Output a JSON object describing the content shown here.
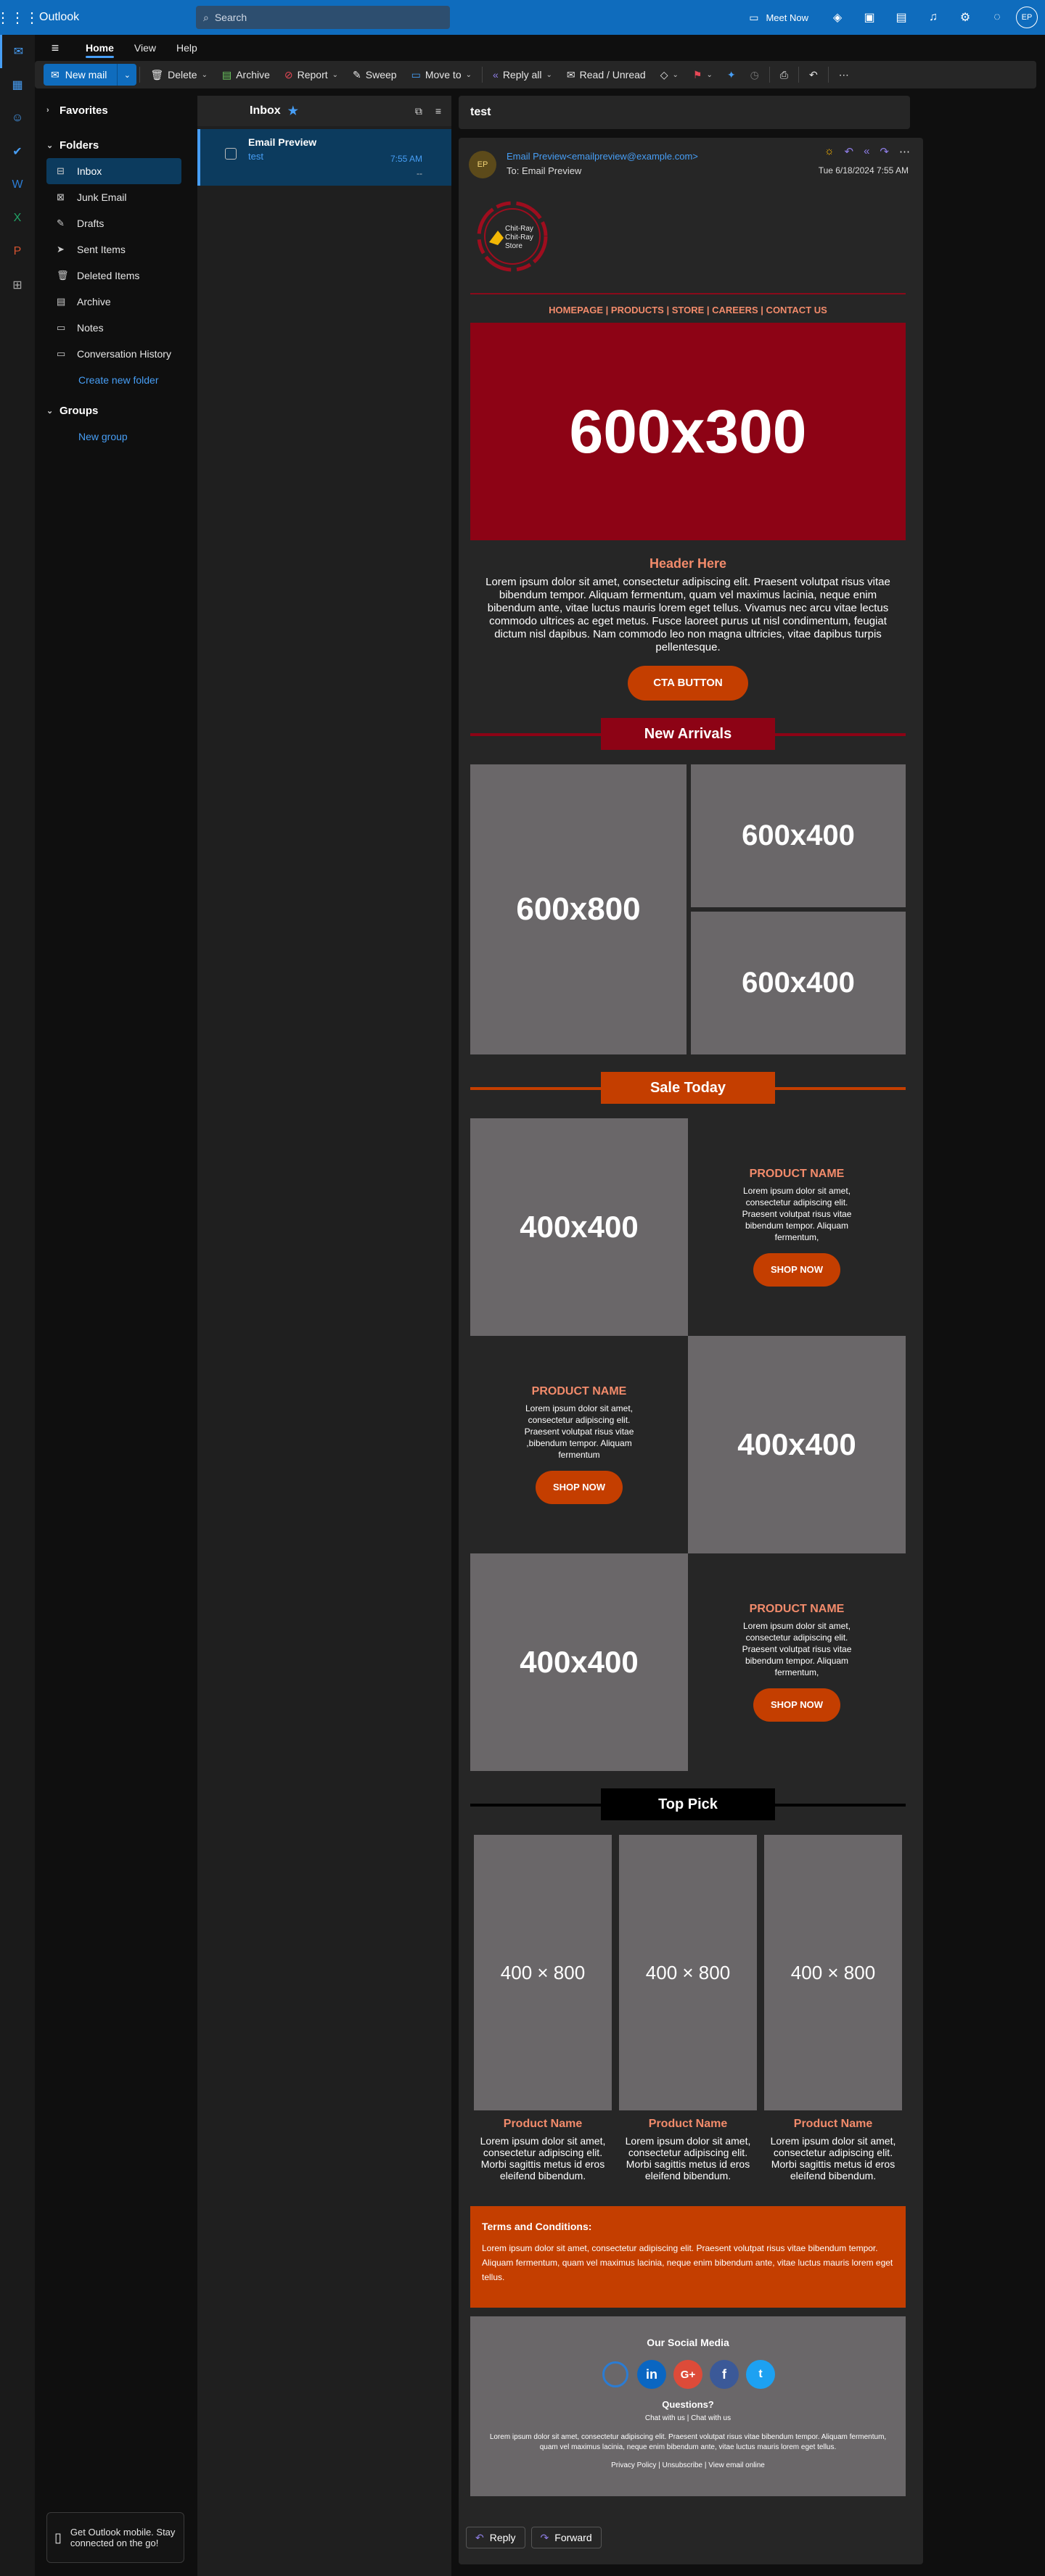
{
  "app": {
    "title": "Outlook",
    "search_placeholder": "Search",
    "meet_now": "Meet Now",
    "user_initials": "EP",
    "accent": "#0f6cbd"
  },
  "ribbon": {
    "tabs": [
      "Home",
      "View",
      "Help"
    ],
    "active_tab": "Home",
    "new_mail": "New mail",
    "delete": "Delete",
    "archive": "Archive",
    "report": "Report",
    "sweep": "Sweep",
    "move_to": "Move to",
    "reply_all": "Reply all",
    "read_unread": "Read / Unread"
  },
  "folders": {
    "favorites": "Favorites",
    "folders_label": "Folders",
    "items": [
      {
        "label": "Inbox",
        "icon": "inbox-icon"
      },
      {
        "label": "Junk Email",
        "icon": "junk-icon"
      },
      {
        "label": "Drafts",
        "icon": "drafts-icon"
      },
      {
        "label": "Sent Items",
        "icon": "sent-icon"
      },
      {
        "label": "Deleted Items",
        "icon": "trash-icon"
      },
      {
        "label": "Archive",
        "icon": "archive-icon"
      },
      {
        "label": "Notes",
        "icon": "notes-icon"
      },
      {
        "label": "Conversation History",
        "icon": "folder-icon"
      }
    ],
    "create_new_folder": "Create new folder",
    "groups_label": "Groups",
    "new_group": "New group",
    "mobile_promo": "Get Outlook mobile. Stay connected on the go!"
  },
  "message_list": {
    "title": "Inbox",
    "messages": [
      {
        "from": "Email Preview",
        "subject": "test",
        "time": "7:55 AM",
        "preview": "--"
      }
    ]
  },
  "reading": {
    "subject": "test",
    "sender_initials": "EP",
    "from": "Email Preview<emailpreview@example.com>",
    "to_label": "To:",
    "to": "Email Preview",
    "date": "Tue 6/18/2024 7:55 AM",
    "reply": "Reply",
    "forward": "Forward"
  },
  "email": {
    "logo_text": [
      "Chit-Ray",
      "Chit-Ray",
      "Store"
    ],
    "nav_links": "HOMEPAGE | PRODUCTS | STORE | CAREERS | CONTACT US",
    "hero": "600x300",
    "header": "Header Here",
    "header_text": "Lorem ipsum dolor sit amet, consectetur adipiscing elit. Praesent volutpat risus vitae bibendum tempor. Aliquam fermentum, quam vel maximus lacinia, neque enim bibendum ante, vitae luctus mauris lorem eget tellus. Vivamus nec arcu vitae lectus commodo ultrices ac eget metus. Fusce laoreet purus ut nisl condimentum, feugiat dictum nisl dapibus. Nam commodo leo non magna ultricies, vitae dapibus turpis pellentesque.",
    "cta": "CTA BUTTON",
    "new_arrivals": "New Arrivals",
    "na_large": "600x800",
    "na_small_1": "600x400",
    "na_small_2": "600x400",
    "sale_today": "Sale Today",
    "products": [
      {
        "image": "400x400",
        "name": "PRODUCT NAME",
        "desc": "Lorem ipsum dolor sit amet, consectetur adipiscing elit. Praesent volutpat risus vitae bibendum tempor. Aliquam fermentum,",
        "button": "SHOP NOW"
      },
      {
        "image": "400x400",
        "name": "PRODUCT NAME",
        "desc": "Lorem ipsum dolor sit amet, consectetur adipiscing elit. Praesent volutpat risus vitae ,bibendum tempor. Aliquam fermentum",
        "button": "SHOP NOW"
      },
      {
        "image": "400x400",
        "name": "PRODUCT NAME",
        "desc": "Lorem ipsum dolor sit amet, consectetur adipiscing elit. Praesent volutpat risus vitae bibendum tempor. Aliquam fermentum,",
        "button": "SHOP NOW"
      }
    ],
    "top_pick": "Top Pick",
    "top_picks": [
      {
        "image": "400 × 800",
        "name": "Product Name",
        "desc": "Lorem ipsum dolor sit amet, consectetur adipiscing elit. Morbi sagittis metus id eros eleifend bibendum."
      },
      {
        "image": "400 × 800",
        "name": "Product Name",
        "desc": "Lorem ipsum dolor sit amet, consectetur adipiscing elit. Morbi sagittis metus id eros eleifend bibendum."
      },
      {
        "image": "400 × 800",
        "name": "Product Name",
        "desc": "Lorem ipsum dolor sit amet, consectetur adipiscing elit. Morbi sagittis metus id eros eleifend bibendum."
      }
    ],
    "terms_title": "Terms and Conditions:",
    "terms_text": "Lorem ipsum dolor sit amet, consectetur adipiscing elit. Praesent volutpat risus vitae bibendum tempor. Aliquam fermentum, quam vel maximus lacinia, neque enim bibendum ante, vitae luctus mauris lorem eget tellus.",
    "social_title": "Our Social Media",
    "social_icons": [
      "circle-icon",
      "linkedin-icon",
      "google-plus-icon",
      "facebook-icon",
      "twitter-icon"
    ],
    "questions": "Questions?",
    "chat": "Chat with us | Chat with us",
    "footer_text": "Lorem ipsum dolor sit amet, consectetur adipiscing elit. Praesent volutpat risus vitae bibendum tempor. Aliquam fermentum, quam vel maximus lacinia, neque enim bibendum ante, vitae luctus mauris lorem eget tellus.",
    "footer_links": "Privacy Policy | Unsubscribe | View email online",
    "colors": {
      "red": "#8d0315",
      "orange": "#c43e00",
      "salmon": "#f28b6b",
      "placeholder": "#6a6769"
    }
  }
}
